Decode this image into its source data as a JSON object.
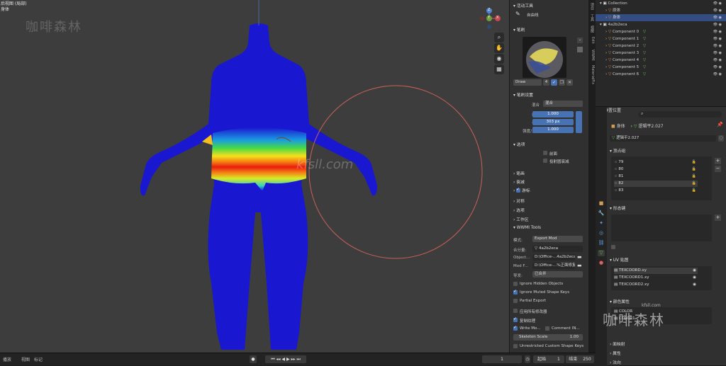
{
  "viewport": {
    "title": "后视图 (局部)",
    "subtitle": "身体",
    "watermark": "咖啡森林",
    "watermark2": "kfsll.com"
  },
  "gizmo": {
    "x": "X",
    "y": "Y",
    "z": "Z"
  },
  "timeline": {
    "items": [
      "播放",
      "视图",
      "标记"
    ],
    "frame": "1",
    "start_label": "起始",
    "start": "1",
    "end_label": "结束",
    "end": "250"
  },
  "npanel": {
    "active_tool_header": "活动工具",
    "tool_name": "自由线",
    "brush_header": "笔刷",
    "brush_name": "Draw",
    "brush_users": "4",
    "brush_settings_header": "笔刷设置",
    "blend_label": "混合",
    "blend_value": "混合",
    "weight_label": "权重",
    "weight_value": "1.000",
    "radius_label": "半径",
    "radius_value": "303 px",
    "strength_label": "强度/力度",
    "strength_value": "1.000",
    "options_header": "选项",
    "front_faces": "前面",
    "falloff_shape": "投射圆衰减",
    "collapsed": [
      "笔画",
      "衰减",
      "游标"
    ],
    "sections": [
      "对称",
      "选项",
      "工作区"
    ],
    "wwmi_header": "WWMI Tools",
    "mode_label": "模式:",
    "mode_value": "Export Mod",
    "component_label": "合分量:",
    "component_value": "4a2b2eca",
    "object_label": "Object...",
    "object_path": "D:\\Office-...4a2b2eca\\",
    "mod_label": "Mod F...",
    "mod_path": "D:\\Office-...%正面修复\\",
    "apply_label": "导发:",
    "apply_value": "已合并",
    "ignore_hidden": "Ignore Hidden Objects",
    "ignore_muted": "Ignore Muted Shape Keys",
    "partial_export": "Partial Export",
    "apply_modifiers": "应用所有修改器",
    "copy_textures": "复制纹理",
    "write_mod": "Write Mo...",
    "comment": "Comment IN...",
    "skeleton_label": "Skeleton Scale",
    "skeleton_value": "1.00",
    "unrestricted": "Unrestricted Custom Shape Keys"
  },
  "sidetabs": [
    "项目",
    "工具",
    "视图",
    "Edit",
    "WWMI",
    "MaterialFix"
  ],
  "outliner": {
    "rows": [
      {
        "name": "Collection",
        "indent": 0
      },
      {
        "name": "原体",
        "indent": 1
      },
      {
        "name": "身体",
        "indent": 1,
        "sel": true
      },
      {
        "name": "4a2b2eca",
        "indent": 0
      },
      {
        "name": "Component 0",
        "indent": 1
      },
      {
        "name": "Component 1",
        "indent": 1
      },
      {
        "name": "Component 2",
        "indent": 1
      },
      {
        "name": "Component 3",
        "indent": 1
      },
      {
        "name": "Component 4",
        "indent": 1
      },
      {
        "name": "Component 5",
        "indent": 1
      },
      {
        "name": "Component 6",
        "indent": 1
      }
    ]
  },
  "props": {
    "breadcrumb_obj": "身体",
    "breadcrumb_mesh": "逻辑平2.027",
    "mesh_name": "逻辑平2.027",
    "vertex_groups_header": "顶点组",
    "vertex_groups": [
      "79",
      "80",
      "81",
      "82",
      "83"
    ],
    "shape_keys_header": "形态键",
    "add_rest": "添加静置位置",
    "uv_header": "UV 贴图",
    "uv_maps": [
      "TEXCOORD.xy",
      "TEXCOORD1.xy",
      "TEXCOORD2.xy"
    ],
    "color_header": "颜色属性",
    "color_attrs": [
      "COLOR",
      "COLOR1"
    ],
    "more": [
      "面映射",
      "属性",
      "法向"
    ]
  },
  "colors": {
    "accent": "#4772b3",
    "select": "#334d80",
    "brush_ring": "#c9605a",
    "mesh": "#1a17d0"
  }
}
